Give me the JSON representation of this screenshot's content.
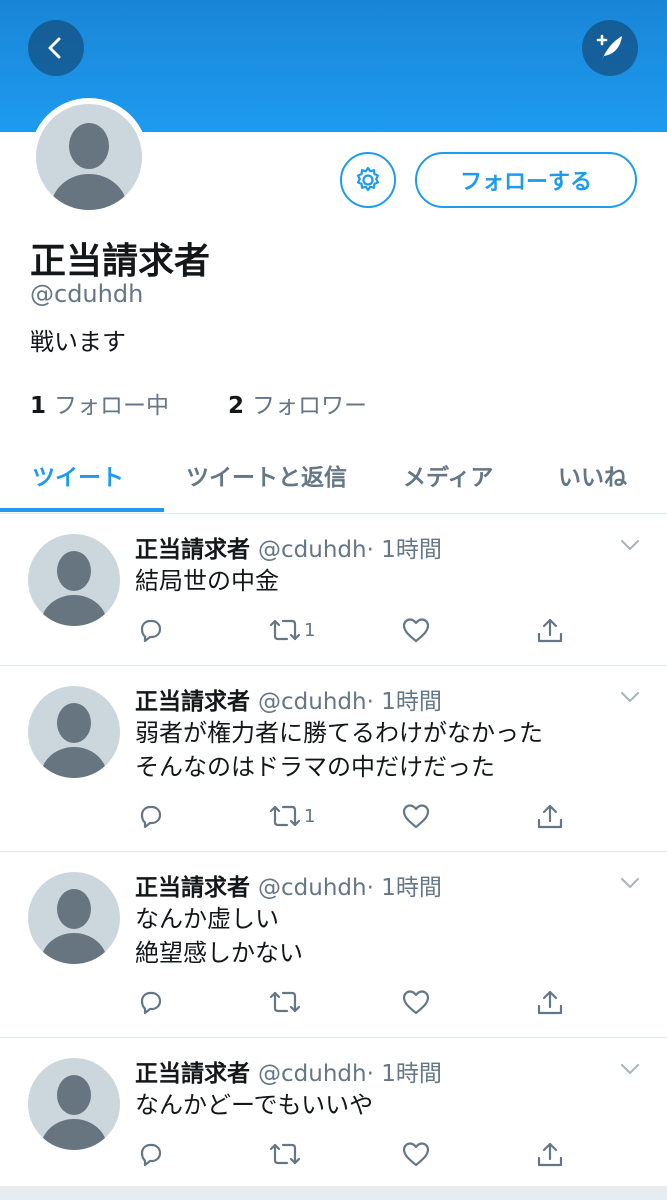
{
  "header": {
    "back_icon": "chevron-left-icon",
    "compose_icon": "compose-tweet-icon",
    "background": "#1d9bf0"
  },
  "profile": {
    "display_name": "正当請求者",
    "handle": "@cduhdh",
    "bio": "戦います",
    "settings_icon": "gear-icon",
    "follow_label": "フォローする",
    "following_count": "1",
    "following_label": "フォロー中",
    "followers_count": "2",
    "followers_label": "フォロワー"
  },
  "tabs": [
    {
      "label": "ツイート",
      "active": true
    },
    {
      "label": "ツイートと返信",
      "active": false
    },
    {
      "label": "メディア",
      "active": false
    },
    {
      "label": "いいね",
      "active": false
    }
  ],
  "tweets": [
    {
      "name": "正当請求者",
      "handle": "@cduhdh",
      "time": "· 1時間",
      "lines": [
        "結局世の中金"
      ],
      "retweets": "1"
    },
    {
      "name": "正当請求者",
      "handle": "@cduhdh",
      "time": "· 1時間",
      "lines": [
        "弱者が権力者に勝てるわけがなかった",
        "そんなのはドラマの中だけだった"
      ],
      "retweets": "1"
    },
    {
      "name": "正当請求者",
      "handle": "@cduhdh",
      "time": "· 1時間",
      "lines": [
        "なんか虚しい",
        "絶望感しかない"
      ],
      "retweets": ""
    },
    {
      "name": "正当請求者",
      "handle": "@cduhdh",
      "time": "· 1時間",
      "lines": [
        "なんかどーでもいいや"
      ],
      "retweets": ""
    }
  ],
  "colors": {
    "accent": "#1d9bf0",
    "secondary_text": "#657786",
    "avatar_placeholder": "#ccd6dd",
    "avatar_silhouette": "#66757f"
  }
}
